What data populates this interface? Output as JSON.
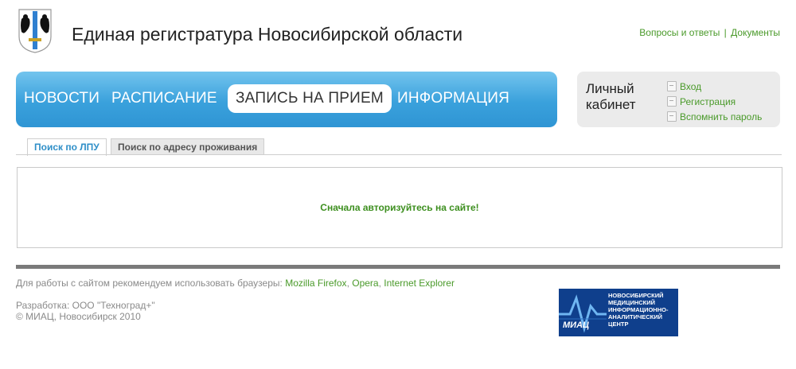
{
  "header": {
    "title": "Единая регистратура Новосибирской области",
    "links": [
      {
        "label": "Вопросы и ответы"
      },
      {
        "label": "Документы"
      }
    ],
    "separator": "|"
  },
  "nav": {
    "items": [
      {
        "label": "НОВОСТИ"
      },
      {
        "label": "РАСПИСАНИЕ"
      },
      {
        "label": "ЗАПИСЬ НА ПРИЕМ"
      },
      {
        "label": "ИНФОРМАЦИЯ"
      }
    ],
    "active_index": 2
  },
  "cabinet": {
    "title": "Личный кабинет",
    "links": [
      {
        "label": "Вход"
      },
      {
        "label": "Регистрация"
      },
      {
        "label": "Вспомнить пароль"
      }
    ]
  },
  "tabs": {
    "items": [
      {
        "label": "Поиск по ЛПУ"
      },
      {
        "label": "Поиск по адресу проживания"
      }
    ],
    "active_index": 0
  },
  "content": {
    "message": "Сначала авторизуйтесь на сайте!"
  },
  "footer": {
    "browsers_text": "Для работы с сайтом рекомендуем использовать браузеры:",
    "browsers": [
      {
        "label": "Mozilla Firefox"
      },
      {
        "label": "Opera"
      },
      {
        "label": "Internet Explorer"
      }
    ],
    "developer": "Разработка: ООО \"Техноград+\"",
    "copyright": "© МИАЦ, Новосибирск 2010",
    "miac_logo": {
      "text": "НОВОСИБИРСКИЙ МЕДИЦИНСКИЙ ИНФОРМАЦИОННО-АНАЛИТИЧЕСКИЙ ЦЕНТР",
      "abbr": "МИАЦ"
    }
  },
  "colors": {
    "link_green": "#4a9a2a",
    "nav_blue": "#3aa1dc",
    "message_green": "#3d8f1f"
  }
}
